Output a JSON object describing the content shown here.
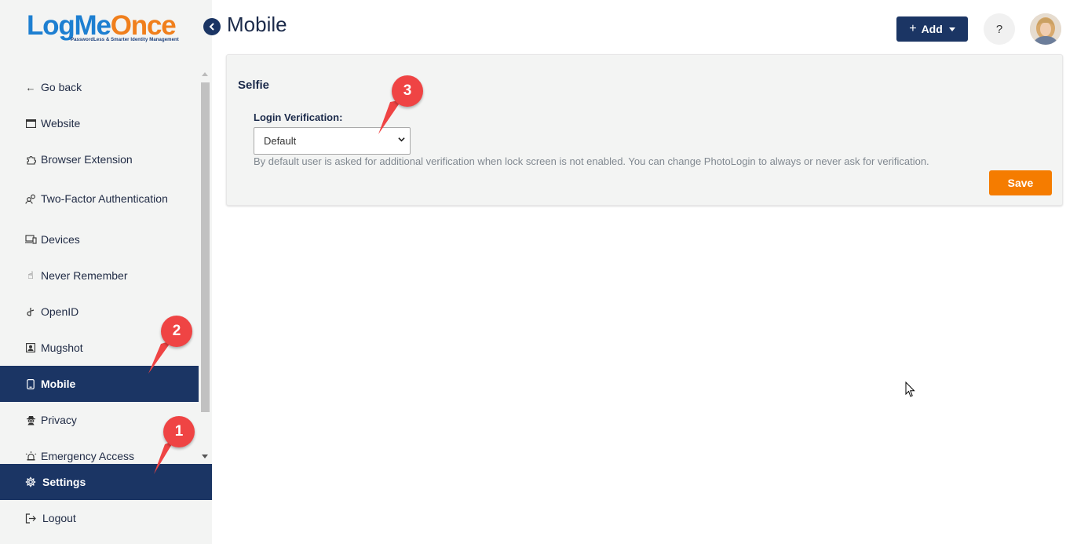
{
  "brand": {
    "logo_part1": "LogMe",
    "logo_part2": "Once",
    "tagline": "PasswordLess & Smarter Identity Management"
  },
  "sidebar": {
    "items": [
      {
        "label": "Go back",
        "icon": "arrow-left-icon",
        "glyph": "←"
      },
      {
        "label": "Website",
        "icon": "window-icon",
        "glyph": "▭"
      },
      {
        "label": "Browser Extension",
        "icon": "puzzle-icon",
        "glyph": "⧉"
      },
      {
        "label": "Two-Factor Authentication",
        "icon": "users-icon",
        "glyph": "⚇"
      },
      {
        "label": "Devices",
        "icon": "devices-icon",
        "glyph": "▭"
      },
      {
        "label": "Never Remember",
        "icon": "hand-pointer-icon",
        "glyph": "☝"
      },
      {
        "label": "OpenID",
        "icon": "openid-icon",
        "glyph": "ძ"
      },
      {
        "label": "Mugshot",
        "icon": "portrait-icon",
        "glyph": "▣"
      },
      {
        "label": "Mobile",
        "icon": "mobile-icon",
        "glyph": "▯"
      },
      {
        "label": "Privacy",
        "icon": "spy-icon",
        "glyph": "☗"
      },
      {
        "label": "Emergency Access",
        "icon": "siren-icon",
        "glyph": "⍾"
      }
    ],
    "active_index": 8,
    "settings_label": "Settings",
    "logout_label": "Logout"
  },
  "header": {
    "title": "Mobile",
    "add_label": "Add",
    "help_label": "?"
  },
  "card": {
    "title": "Selfie",
    "field_label": "Login Verification:",
    "select_value": "Default",
    "help_text": "By default user is asked for additional verification when lock screen is not enabled. You can change PhotoLogin to always or never ask for verification.",
    "save_label": "Save"
  },
  "callouts": {
    "one": "1",
    "two": "2",
    "three": "3"
  },
  "colors": {
    "navy": "#1b3564",
    "orange": "#f57c00",
    "callout_red": "#ef4444"
  }
}
